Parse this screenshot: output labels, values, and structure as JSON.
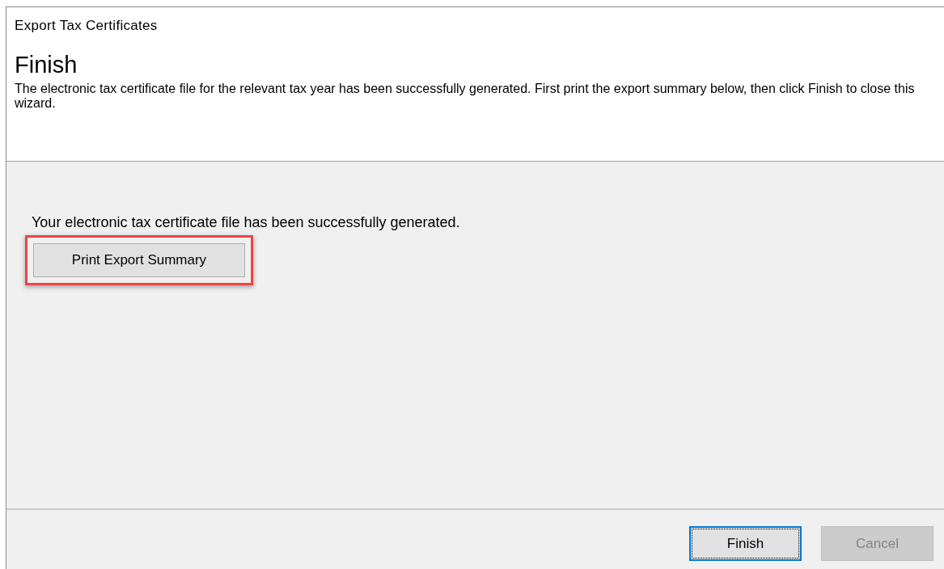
{
  "window": {
    "title": "Export Tax Certificates"
  },
  "header": {
    "heading": "Finish",
    "description": "The electronic tax certificate file for the relevant tax year has been successfully generated. First print the export summary below, then click Finish to close this wizard."
  },
  "body": {
    "message": "Your electronic tax certificate file has been successfully generated.",
    "print_button": {
      "label": "Print Export Summary",
      "highlighted": true
    }
  },
  "buttons": [
    {
      "label": "Finish",
      "focused": true,
      "disabled": false
    },
    {
      "label": "Cancel",
      "focused": false,
      "disabled": true
    }
  ]
}
